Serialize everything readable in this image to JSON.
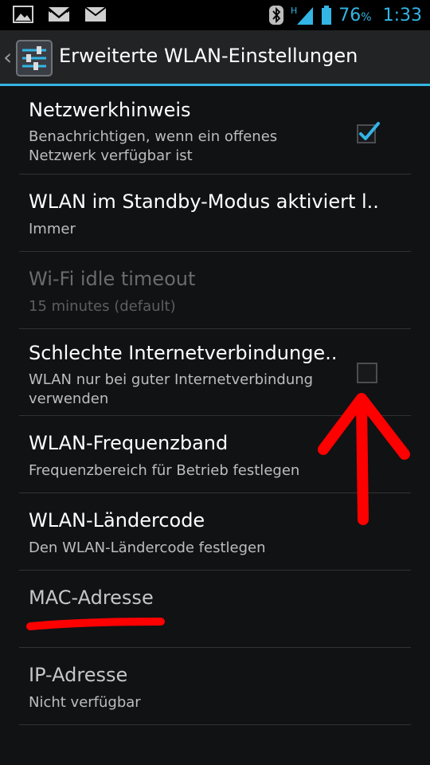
{
  "status_bar": {
    "battery_percent": "76",
    "percent_sign": "%",
    "network_type": "H",
    "clock": "1:33",
    "notification_icons": [
      "gallery-icon",
      "gmail-icon",
      "email-icon"
    ],
    "system_icons": [
      "bluetooth-icon",
      "signal-icon",
      "battery-icon"
    ]
  },
  "action_bar": {
    "title": "Erweiterte WLAN-Einstellungen",
    "back_icon": "chevron-left-icon",
    "app_icon": "settings-sliders-icon"
  },
  "preferences": [
    {
      "title": "Netzwerkhinweis",
      "summary": "Benachrichtigen, wenn ein offenes Netzwerk verfügbar ist",
      "checked": true
    },
    {
      "title": "WLAN im Standby-Modus aktiviert l..",
      "summary": "Immer"
    },
    {
      "title": "Wi-Fi idle timeout",
      "summary": "15 minutes (default)",
      "enabled": false
    },
    {
      "title": "Schlechte Internetverbindunge..",
      "summary": "WLAN nur bei guter Internetverbindung verwenden",
      "checked": false
    },
    {
      "title": "WLAN-Frequenzband",
      "summary": "Frequenzbereich für Betrieb festlegen"
    },
    {
      "title": "WLAN-Ländercode",
      "summary": "Den WLAN-Ländercode festlegen"
    },
    {
      "title": "MAC-Adresse",
      "summary": ""
    },
    {
      "title": "IP-Adresse",
      "summary": "Nicht verfügbar"
    }
  ],
  "colors": {
    "accent": "#33b5e5",
    "background": "#111214",
    "action_bar": "#222325",
    "annotation": "#ff0000"
  }
}
